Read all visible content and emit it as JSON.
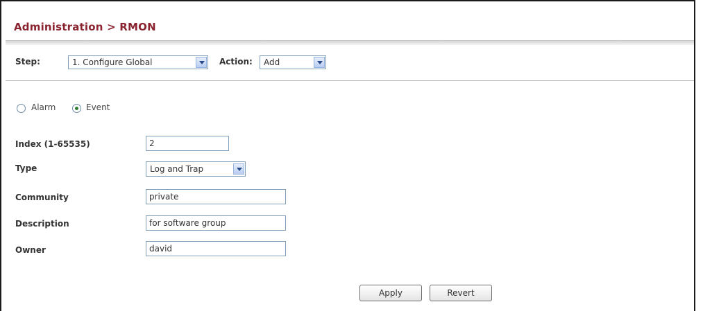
{
  "header": {
    "title": "Administration > RMON"
  },
  "toolbar": {
    "step_label": "Step:",
    "step_value": "1. Configure Global",
    "action_label": "Action:",
    "action_value": "Add"
  },
  "radios": {
    "alarm_label": "Alarm",
    "event_label": "Event",
    "selected": "Event"
  },
  "form": {
    "index": {
      "label": "Index (1-65535)",
      "value": "2"
    },
    "type": {
      "label": "Type",
      "value": "Log and Trap"
    },
    "community": {
      "label": "Community",
      "value": "private"
    },
    "description": {
      "label": "Description",
      "value": "for software group"
    },
    "owner": {
      "label": "Owner",
      "value": "david"
    }
  },
  "buttons": {
    "apply": "Apply",
    "revert": "Revert"
  },
  "colors": {
    "title": "#8a2430",
    "input_border": "#7f9db9"
  }
}
